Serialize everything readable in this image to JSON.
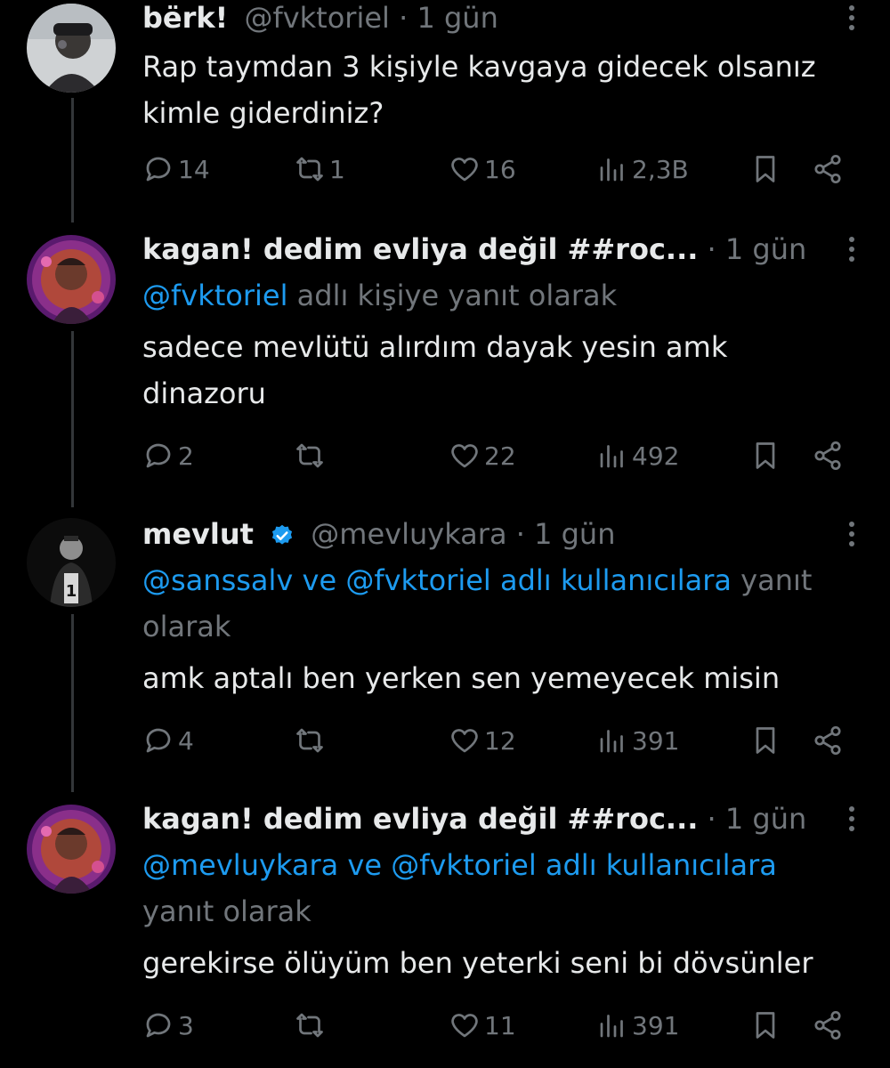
{
  "colors": {
    "background": "#000000",
    "text": "#e7e9ea",
    "muted": "#71767b",
    "link": "#1d9bf0",
    "thread_line": "#333639",
    "verified": "#1d9bf0"
  },
  "tweets": [
    {
      "name": "bërk!",
      "handle": "@fvktoriel",
      "time": "1 gün",
      "reply_to": null,
      "text_lines": [
        "Rap taymdan 3 kişiyle kavgaya gidecek olsanız",
        "kimle giderdiniz?"
      ],
      "stats": {
        "replies": "14",
        "retweets": "1",
        "likes": "16",
        "views": "2,3B"
      }
    },
    {
      "name": "kagan! dedim evliya değil ##roc...",
      "handle": "",
      "time": "1 gün",
      "reply_to": {
        "mentions": "@fvktoriel",
        "suffix": " adlı kişiye yanıt olarak",
        "line2": ""
      },
      "text_lines": [
        "sadece mevlütü alırdım dayak yesin amk",
        "dinazoru"
      ],
      "stats": {
        "replies": "2",
        "retweets": "",
        "likes": "22",
        "views": "492"
      }
    },
    {
      "name": "mevlut",
      "handle": "@mevluykara",
      "verified": true,
      "time": "1 gün",
      "reply_to": {
        "mentions": "@sanssalv ve @fvktoriel adlı kullanıcılara",
        "suffix": " yanıt",
        "line2": "olarak"
      },
      "text_lines": [
        "amk aptalı ben yerken sen yemeyecek misin"
      ],
      "stats": {
        "replies": "4",
        "retweets": "",
        "likes": "12",
        "views": "391"
      }
    },
    {
      "name": "kagan! dedim evliya değil ##roc...",
      "handle": "",
      "time": "1 gün",
      "reply_to": {
        "mentions": "@mevluykara ve @fvktoriel adlı kullanıcılara",
        "suffix": "",
        "line2": "yanıt olarak"
      },
      "text_lines": [
        "gerekirse ölüyüm ben yeterki seni bi dövsünler"
      ],
      "stats": {
        "replies": "3",
        "retweets": "",
        "likes": "11",
        "views": "391"
      }
    }
  ],
  "icons": {
    "reply": "reply-icon",
    "retweet": "retweet-icon",
    "like": "heart-icon",
    "views": "views-icon",
    "bookmark": "bookmark-icon",
    "share": "share-icon",
    "more": "more-vertical-icon"
  }
}
